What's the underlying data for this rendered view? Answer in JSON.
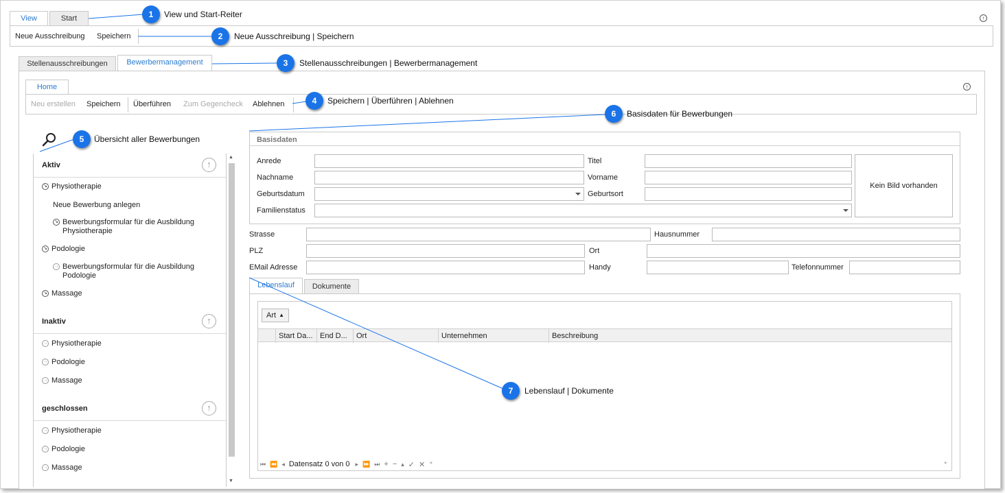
{
  "outer_tabs": {
    "view": "View",
    "start": "Start"
  },
  "main_toolbar": {
    "new_posting": "Neue Ausschreibung",
    "save": "Speichern"
  },
  "module_tabs": {
    "postings": "Stellenausschreibungen",
    "applicants": "Bewerbermanagement"
  },
  "home_tab": "Home",
  "home_toolbar": {
    "new": "Neu erstellen",
    "save": "Speichern",
    "transfer": "Überführen",
    "crosscheck": "Zum Gegencheck",
    "reject": "Ablehnen"
  },
  "nav": {
    "groups": [
      {
        "title": "Aktiv",
        "items": [
          {
            "label": "Physiotherapie",
            "icon": "arrow-down-right-circle-icon"
          },
          {
            "label": "Neue Bewerbung anlegen",
            "icon": ""
          },
          {
            "label": "Bewerbungsformular für die Ausbildung Physiotherapie",
            "icon": "arrow-down-right-circle-icon"
          },
          {
            "label": "Podologie",
            "icon": "arrow-down-right-circle-icon"
          },
          {
            "label": "Bewerbungsformular für die Ausbildung Podologie",
            "icon": "arrow-right-circle-icon"
          },
          {
            "label": "Massage",
            "icon": "arrow-down-right-circle-icon"
          }
        ]
      },
      {
        "title": "Inaktiv",
        "items": [
          {
            "label": "Physiotherapie",
            "icon": "arrow-right-circle-icon"
          },
          {
            "label": "Podologie",
            "icon": "arrow-right-circle-icon"
          },
          {
            "label": "Massage",
            "icon": "arrow-right-circle-icon"
          }
        ]
      },
      {
        "title": "geschlossen",
        "items": [
          {
            "label": "Physiotherapie",
            "icon": "arrow-right-circle-icon"
          },
          {
            "label": "Podologie",
            "icon": "arrow-right-circle-icon"
          },
          {
            "label": "Massage",
            "icon": "arrow-right-circle-icon"
          }
        ]
      }
    ]
  },
  "basisdaten": {
    "title": "Basisdaten",
    "anrede": "Anrede",
    "titel": "Titel",
    "nachname": "Nachname",
    "vorname": "Vorname",
    "geburtsdatum": "Geburtsdatum",
    "geburtsort": "Geburtsort",
    "familienstatus": "Familienstatus",
    "kein_bild": "Kein Bild vorhanden"
  },
  "address": {
    "strasse": "Strasse",
    "hausnummer": "Hausnummer",
    "plz": "PLZ",
    "ort": "Ort",
    "email": "EMail Adresse",
    "handy": "Handy",
    "telefon": "Telefonnummer"
  },
  "detail_tabs": {
    "lebenslauf": "Lebenslauf",
    "dokumente": "Dokumente"
  },
  "grid": {
    "group_by": "Art",
    "columns": [
      "Start Da...",
      "End D...",
      "Ort",
      "Unternehmen",
      "Beschreibung"
    ],
    "record_text": "Datensatz 0 von 0"
  },
  "callouts": [
    {
      "num": "1",
      "text": "View und Start-Reiter"
    },
    {
      "num": "2",
      "text": "Neue Ausschreibung | Speichern"
    },
    {
      "num": "3",
      "text": "Stellenausschreibungen | Bewerbermanagement"
    },
    {
      "num": "4",
      "text": "Speichern | Überführen | Ablehnen"
    },
    {
      "num": "5",
      "text": "Übersicht aller Bewerbungen"
    },
    {
      "num": "6",
      "text": "Basisdaten für Bewerbungen"
    },
    {
      "num": "7",
      "text": "Lebenslauf | Dokumente"
    }
  ],
  "colors": {
    "accent": "#2a7bd0",
    "callout": "#1a74e8"
  }
}
